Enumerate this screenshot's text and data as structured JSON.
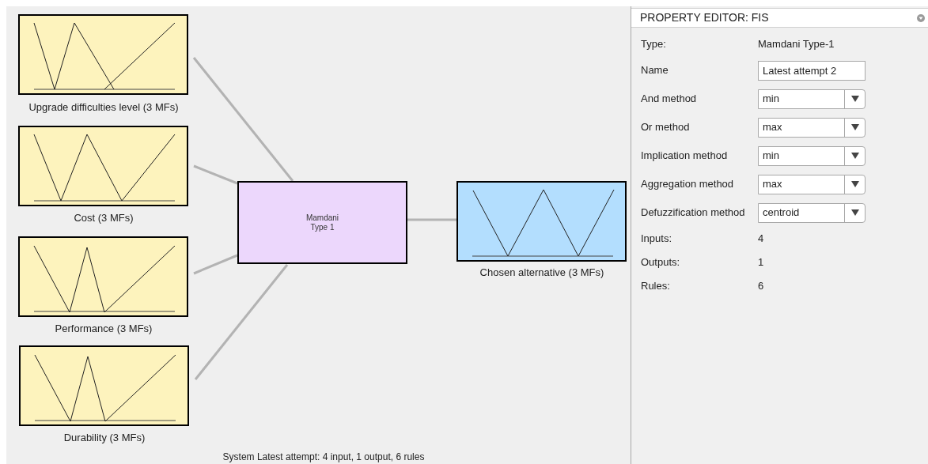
{
  "diagram": {
    "inputs": [
      {
        "label": "Upgrade difficulties level (3 MFs)"
      },
      {
        "label": "Cost (3 MFs)"
      },
      {
        "label": "Performance (3 MFs)"
      },
      {
        "label": "Durability (3 MFs)"
      }
    ],
    "system": {
      "lines": [
        "Mamdani",
        "Type 1"
      ]
    },
    "outputs": [
      {
        "label": "Chosen alternative (3 MFs)"
      }
    ],
    "status": "System Latest attempt: 4 input, 1 output, 6 rules"
  },
  "property_editor": {
    "title": "PROPERTY EDITOR: FIS",
    "rows": [
      {
        "kind": "text",
        "label": "Type:",
        "value": "Mamdani Type-1"
      },
      {
        "kind": "input",
        "label": "Name",
        "value": "Latest attempt 2"
      },
      {
        "kind": "dropdown",
        "label": "And method",
        "value": "min"
      },
      {
        "kind": "dropdown",
        "label": "Or method",
        "value": "max"
      },
      {
        "kind": "dropdown",
        "label": "Implication method",
        "value": "min"
      },
      {
        "kind": "dropdown",
        "label": "Aggregation method",
        "value": "max"
      },
      {
        "kind": "dropdown",
        "label": "Defuzzification method",
        "value": "centroid"
      },
      {
        "kind": "text",
        "label": "Inputs:",
        "value": "4"
      },
      {
        "kind": "text",
        "label": "Outputs:",
        "value": "1"
      },
      {
        "kind": "text",
        "label": "Rules:",
        "value": "6"
      }
    ]
  }
}
